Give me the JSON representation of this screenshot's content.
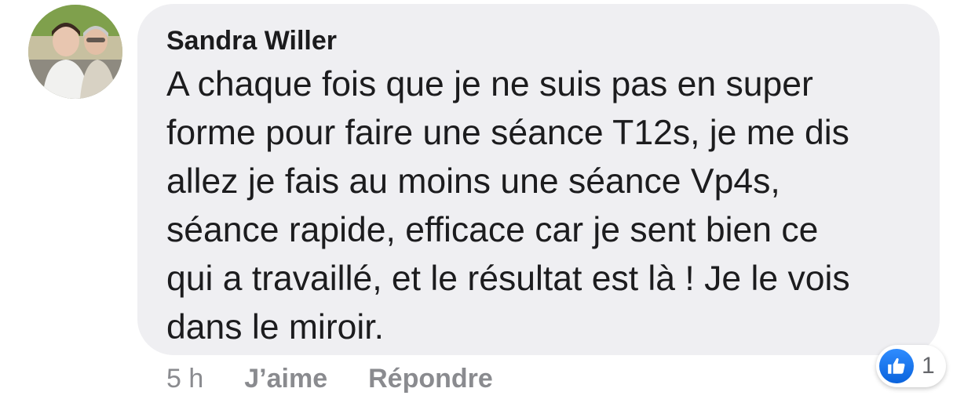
{
  "comment": {
    "author": "Sandra Willer",
    "text": "A chaque fois que je ne suis pas en super\nforme pour faire une séance T12s, je me dis\nallez je fais au moins une séance Vp4s,\nséance rapide, efficace car je sent bien ce\nqui a travaillé, et le résultat est là ! Je le vois\ndans le miroir.",
    "avatar_icon": "profile-photo",
    "bubble_color": "#efeff2"
  },
  "actions": {
    "timestamp": "5 h",
    "like_label": "J’aime",
    "reply_label": "Répondre"
  },
  "reactions": {
    "icon": "thumbs-up-icon",
    "count": "1",
    "color": "#1877f2"
  }
}
